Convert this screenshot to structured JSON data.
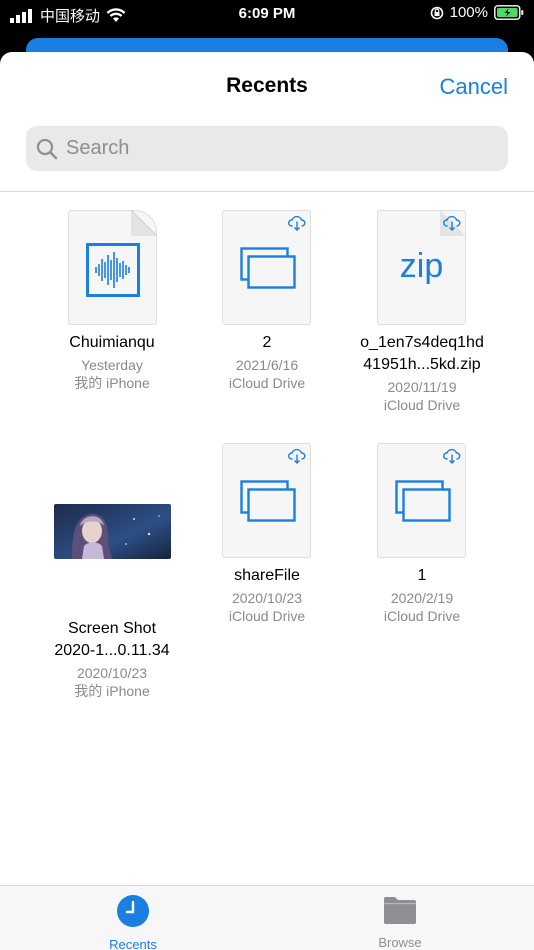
{
  "status": {
    "carrier": "中国移动",
    "time": "6:09 PM",
    "battery": "100%"
  },
  "header": {
    "title": "Recents",
    "cancel_label": "Cancel"
  },
  "search": {
    "placeholder": "Search"
  },
  "files": [
    {
      "name1": "Chuimianqu",
      "name2": "",
      "meta1": "Yesterday",
      "meta2": "我的 iPhone",
      "kind": "audio",
      "cloud": false
    },
    {
      "name1": "2",
      "name2": "",
      "meta1": "2021/6/16",
      "meta2": "iCloud Drive",
      "kind": "folder",
      "cloud": true
    },
    {
      "name1": "o_1en7s4deq1hd",
      "name2": "41951h...5kd.zip",
      "meta1": "2020/11/19",
      "meta2": "iCloud Drive",
      "kind": "zip",
      "zip_label": "zip",
      "cloud": true
    },
    {
      "name1": "Screen Shot",
      "name2": "2020-1...0.11.34",
      "meta1": "2020/10/23",
      "meta2": "我的 iPhone",
      "kind": "image",
      "cloud": false
    },
    {
      "name1": "shareFile",
      "name2": "",
      "meta1": "2020/10/23",
      "meta2": "iCloud Drive",
      "kind": "folder",
      "cloud": true
    },
    {
      "name1": "1",
      "name2": "",
      "meta1": "2020/2/19",
      "meta2": "iCloud Drive",
      "kind": "folder",
      "cloud": true
    }
  ],
  "tabs": [
    {
      "label": "Recents",
      "icon": "clock-icon",
      "active": true
    },
    {
      "label": "Browse",
      "icon": "folder-icon",
      "active": false
    }
  ],
  "colors": {
    "accent": "#1a7fe0",
    "inactive": "#8e8e93"
  }
}
